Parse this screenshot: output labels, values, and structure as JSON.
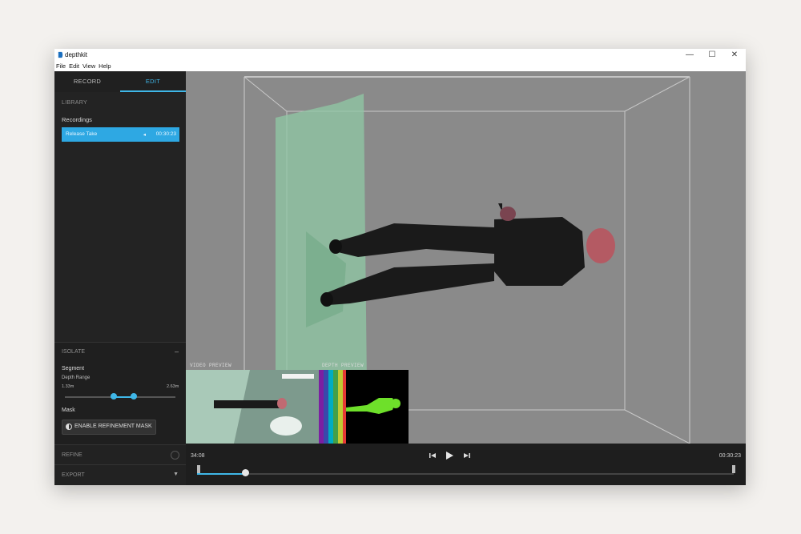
{
  "window": {
    "title": "depthkit",
    "controls": {
      "minimize": "—",
      "maximize": "☐",
      "close": "✕"
    }
  },
  "menu": [
    "File",
    "Edit",
    "View",
    "Help"
  ],
  "tabs": {
    "record": "RECORD",
    "edit": "EDIT",
    "active": "edit"
  },
  "library": {
    "header": "LIBRARY",
    "recordings_label": "Recordings",
    "items": [
      {
        "name": "Release Take",
        "duration": "00:30:23"
      }
    ]
  },
  "isolate": {
    "header": "ISOLATE",
    "segment_label": "Segment",
    "depth_range_label": "Depth Range",
    "range_min": "1.33m",
    "range_max": "2.63m",
    "range_low_fraction": 0.44,
    "range_high_fraction": 0.62,
    "mask_label": "Mask",
    "mask_button": "ENABLE REFINEMENT MASK"
  },
  "refine": {
    "label": "REFINE"
  },
  "export": {
    "label": "EXPORT"
  },
  "previews": {
    "video_label": "VIDEO PREVIEW",
    "depth_label": "DEPTH PREVIEW"
  },
  "timeline": {
    "current_time": "34:08",
    "end_time": "00:30:23",
    "progress_fraction": 0.09
  },
  "colors": {
    "accent": "#3fb7e8",
    "panel": "#232323",
    "viewport": "#8a8a8a"
  }
}
